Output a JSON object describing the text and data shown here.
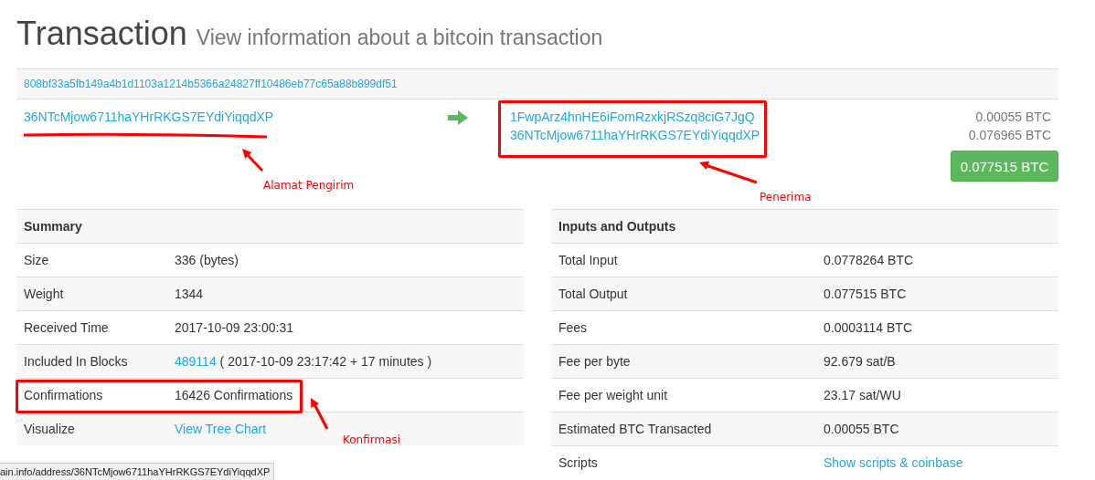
{
  "page_title": "Transaction",
  "page_subtitle": "View information about a bitcoin transaction",
  "transaction": {
    "hash": "808bf33a5fb149a4b1d1103a1214b5366a24827ff10486eb77c65a88b899df51",
    "inputs": [
      {
        "address": "36NTcMjow6711haYHrRKGS7EYdiYiqqdXP"
      }
    ],
    "outputs": [
      {
        "address": "1FwpArz4hnHE6iFomRzxkjRSzq8ciG7JgQ",
        "amount": "0.00055 BTC"
      },
      {
        "address": "36NTcMjow6711haYHrRKGS7EYdiYiqqdXP",
        "amount": "0.076965 BTC"
      }
    ],
    "total": "0.077515 BTC"
  },
  "summary": {
    "title": "Summary",
    "rows": [
      {
        "kind": "text",
        "label": "Size",
        "value": "336 (bytes)"
      },
      {
        "kind": "text",
        "label": "Weight",
        "value": "1344"
      },
      {
        "kind": "text",
        "label": "Received Time",
        "value": "2017-10-09 23:00:31"
      },
      {
        "kind": "link_note",
        "label": "Included In Blocks",
        "value": "489114",
        "note": "( 2017-10-09 23:17:42 + 17 minutes )"
      },
      {
        "kind": "text",
        "label": "Confirmations",
        "value": "16426 Confirmations"
      },
      {
        "kind": "link",
        "label": "Visualize",
        "value": "View Tree Chart"
      }
    ]
  },
  "inputs_outputs": {
    "title": "Inputs and Outputs",
    "rows": [
      {
        "kind": "text",
        "label": "Total Input",
        "value": "0.0778264 BTC"
      },
      {
        "kind": "text",
        "label": "Total Output",
        "value": "0.077515 BTC"
      },
      {
        "kind": "text",
        "label": "Fees",
        "value": "0.0003114 BTC"
      },
      {
        "kind": "text",
        "label": "Fee per byte",
        "value": "92.679 sat/B"
      },
      {
        "kind": "text",
        "label": "Fee per weight unit",
        "value": "23.17 sat/WU"
      },
      {
        "kind": "text",
        "label": "Estimated BTC Transacted",
        "value": "0.00055 BTC"
      },
      {
        "kind": "link",
        "label": "Scripts",
        "value": "Show scripts & coinbase"
      }
    ]
  },
  "annotations": [
    {
      "text": "Alamat Pengirim"
    },
    {
      "text": "Penerima"
    },
    {
      "text": "Konfirmasi"
    }
  ],
  "status_bar": {
    "url": "ain.info/address/36NTcMjow6711haYHrRKGS7EYdiYiqqdXP"
  }
}
